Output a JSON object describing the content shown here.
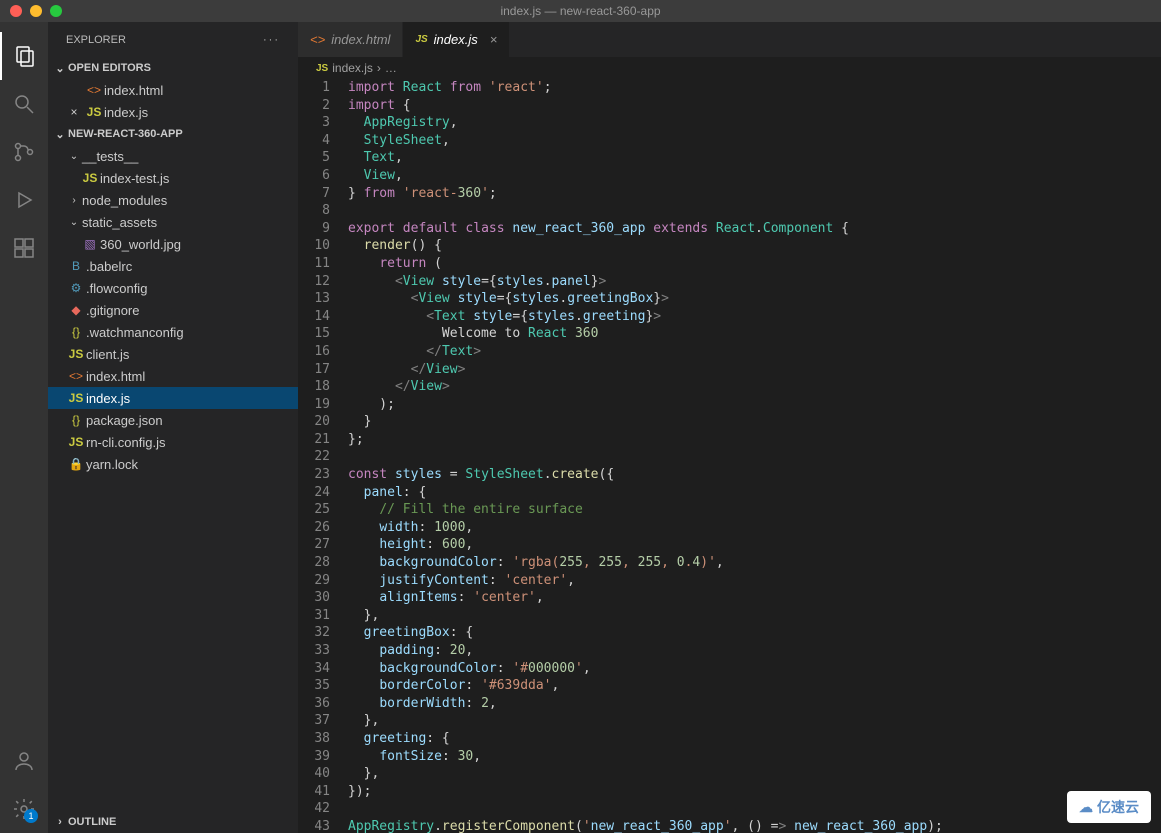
{
  "titlebar": {
    "title": "index.js — new-react-360-app"
  },
  "activity": {
    "badge": "1"
  },
  "sidebar": {
    "title": "EXPLORER",
    "open_editors": {
      "label": "OPEN EDITORS",
      "items": [
        {
          "icon": "<>",
          "name": "index.html",
          "close": ""
        },
        {
          "icon": "JS",
          "name": "index.js",
          "close": "×"
        }
      ]
    },
    "project": {
      "label": "NEW-REACT-360-APP",
      "tree": [
        {
          "type": "folder",
          "name": "__tests__",
          "open": true,
          "depth": 1
        },
        {
          "type": "file",
          "name": "index-test.js",
          "icon": "JS",
          "cls": "ic-js",
          "depth": 2
        },
        {
          "type": "folder",
          "name": "node_modules",
          "open": false,
          "depth": 1
        },
        {
          "type": "folder",
          "name": "static_assets",
          "open": true,
          "depth": 1
        },
        {
          "type": "file",
          "name": "360_world.jpg",
          "icon": "▧",
          "cls": "ic-img",
          "depth": 2
        },
        {
          "type": "file",
          "name": ".babelrc",
          "icon": "B",
          "cls": "ic-conf",
          "depth": 1
        },
        {
          "type": "file",
          "name": ".flowconfig",
          "icon": "⚙",
          "cls": "ic-conf",
          "depth": 1
        },
        {
          "type": "file",
          "name": ".gitignore",
          "icon": "◆",
          "cls": "ic-git",
          "depth": 1
        },
        {
          "type": "file",
          "name": ".watchmanconfig",
          "icon": "{}",
          "cls": "ic-json",
          "depth": 1
        },
        {
          "type": "file",
          "name": "client.js",
          "icon": "JS",
          "cls": "ic-js",
          "depth": 1
        },
        {
          "type": "file",
          "name": "index.html",
          "icon": "<>",
          "cls": "ic-html",
          "depth": 1
        },
        {
          "type": "file",
          "name": "index.js",
          "icon": "JS",
          "cls": "ic-js",
          "depth": 1,
          "selected": true
        },
        {
          "type": "file",
          "name": "package.json",
          "icon": "{}",
          "cls": "ic-json",
          "depth": 1
        },
        {
          "type": "file",
          "name": "rn-cli.config.js",
          "icon": "JS",
          "cls": "ic-js",
          "depth": 1
        },
        {
          "type": "file",
          "name": "yarn.lock",
          "icon": "🔒",
          "cls": "ic-lock",
          "depth": 1
        }
      ]
    },
    "outline": {
      "label": "OUTLINE"
    }
  },
  "tabs": [
    {
      "icon": "<>",
      "label": "index.html",
      "cls": "ic-html",
      "active": false
    },
    {
      "icon": "JS",
      "label": "index.js",
      "cls": "ic-js",
      "active": true
    }
  ],
  "breadcrumb": {
    "icon": "JS",
    "file": "index.js",
    "sep": "›",
    "more": "…"
  },
  "code": {
    "lines": [
      "import React from 'react';",
      "import {",
      "  AppRegistry,",
      "  StyleSheet,",
      "  Text,",
      "  View,",
      "} from 'react-360';",
      "",
      "export default class new_react_360_app extends React.Component {",
      "  render() {",
      "    return (",
      "      <View style={styles.panel}>",
      "        <View style={styles.greetingBox}>",
      "          <Text style={styles.greeting}>",
      "            Welcome to React 360",
      "          </Text>",
      "        </View>",
      "      </View>",
      "    );",
      "  }",
      "};",
      "",
      "const styles = StyleSheet.create({",
      "  panel: {",
      "    // Fill the entire surface",
      "    width: 1000,",
      "    height: 600,",
      "    backgroundColor: 'rgba(255, 255, 255, 0.4)',",
      "    justifyContent: 'center',",
      "    alignItems: 'center',",
      "  },",
      "  greetingBox: {",
      "    padding: 20,",
      "    backgroundColor: '#000000',",
      "    borderColor: '#639dda',",
      "    borderWidth: 2,",
      "  },",
      "  greeting: {",
      "    fontSize: 30,",
      "  },",
      "});",
      "",
      "AppRegistry.registerComponent('new_react_360_app', () => new_react_360_app);"
    ]
  },
  "watermark": "亿速云"
}
